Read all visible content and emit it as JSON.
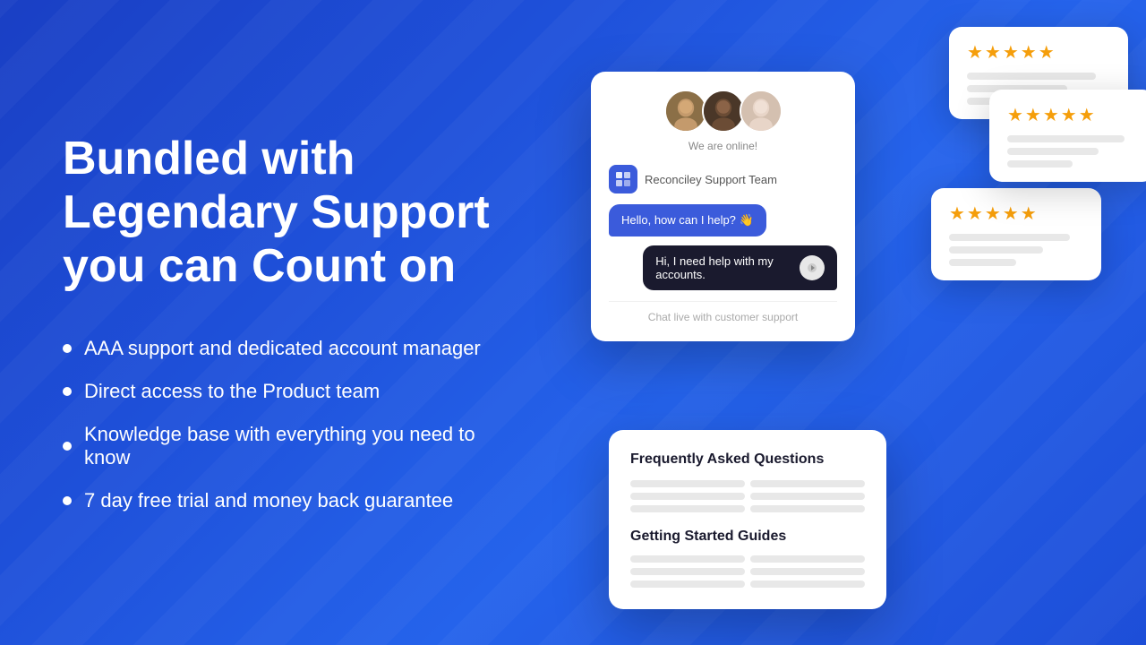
{
  "headline": "Bundled with Legendary Support you can Count on",
  "bullets": [
    "AAA support and dedicated account manager",
    "Direct access to the Product team",
    "Knowledge base with everything you need to know",
    "7 day free trial and money back guarantee"
  ],
  "chat": {
    "online_status": "We are online!",
    "support_team": "Reconciley Support Team",
    "bot_message": "Hello, how can I help? 👋",
    "user_message": "Hi, I need help with my accounts.",
    "input_placeholder": "Chat live with customer support"
  },
  "reviews": [
    {
      "stars": "★★★★★"
    },
    {
      "stars": "★★★★★"
    },
    {
      "stars": "★★★★★"
    }
  ],
  "faq": {
    "title": "Frequently Asked Questions",
    "guide_title": "Getting Started Guides"
  },
  "icons": {
    "support": "///",
    "send": "➤"
  }
}
